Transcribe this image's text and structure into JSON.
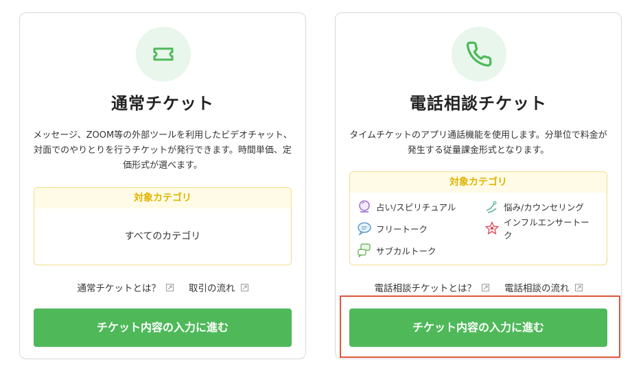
{
  "cards": {
    "normal": {
      "icon": "ticket-icon",
      "title": "通常チケット",
      "description": "メッセージ、ZOOM等の外部ツールを利用したビデオチャット、対面でのやりとりを行うチケットが発行できます。時間単価、定価形式が選べます。",
      "category_heading": "対象カテゴリ",
      "category_all": "すべてのカテゴリ",
      "link_about": "通常チケットとは？",
      "link_flow": "取引の流れ",
      "cta": "チケット内容の入力に進む"
    },
    "phone": {
      "icon": "phone-icon",
      "title": "電話相談チケット",
      "description": "タイムチケットのアプリ通話機能を使用します。分単位で料金が発生する従量課金形式となります。",
      "category_heading": "対象カテゴリ",
      "categories": [
        {
          "label": "占い/スピリチュアル",
          "icon": "crystal-ball-icon"
        },
        {
          "label": "悩み/カウンセリング",
          "icon": "hands-icon"
        },
        {
          "label": "フリートーク",
          "icon": "speech-bubble-icon"
        },
        {
          "label": "インフルエンサートーク",
          "icon": "star-influencer-icon"
        },
        {
          "label": "サブカルトーク",
          "icon": "chat-bubbles-icon"
        }
      ],
      "link_about": "電話相談チケットとは？",
      "link_flow": "電話相談の流れ",
      "cta": "チケット内容の入力に進む"
    }
  },
  "colors": {
    "accent_green": "#4fb95a",
    "icon_bg": "#e8f6ec",
    "category_yellow": "#e0b400",
    "highlight_red": "#e0553a"
  }
}
